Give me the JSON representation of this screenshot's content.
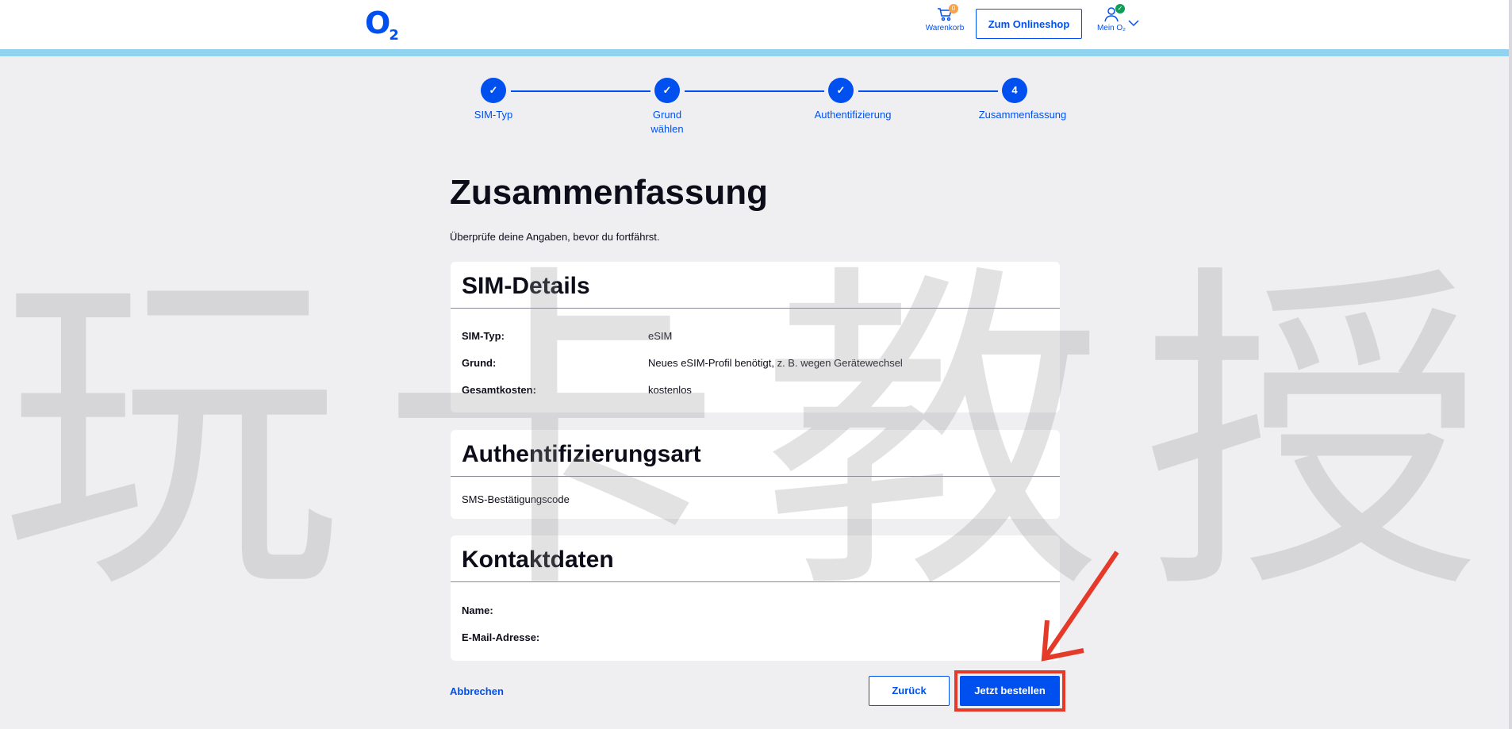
{
  "header": {
    "logo": "O",
    "logo_sub": "2",
    "cart_label": "Warenkorb",
    "cart_count": "0",
    "shop_button": "Zum Onlineshop",
    "account_label": "Mein O₂"
  },
  "stepper": {
    "steps": [
      {
        "label": "SIM-Typ",
        "state": "done"
      },
      {
        "label": "Grund wählen",
        "state": "done"
      },
      {
        "label": "Authentifizierung",
        "state": "done"
      },
      {
        "label": "Zusammenfassung",
        "number": "4",
        "state": "active"
      }
    ]
  },
  "main": {
    "title": "Zusammenfassung",
    "subtitle": "Überprüfe deine Angaben, bevor du fortfährst."
  },
  "sim_details": {
    "heading": "SIM-Details",
    "rows": [
      {
        "label": "SIM-Typ:",
        "value": "eSIM"
      },
      {
        "label": "Grund:",
        "value": "Neues eSIM-Profil benötigt, z. B. wegen Gerätewechsel"
      },
      {
        "label": "Gesamtkosten:",
        "value": "kostenlos"
      }
    ]
  },
  "auth": {
    "heading": "Authentifizierungsart",
    "value": "SMS-Bestätigungscode"
  },
  "contact": {
    "heading": "Kontaktdaten",
    "rows": [
      {
        "label": "Name:",
        "value": ""
      },
      {
        "label": "E-Mail-Adresse:",
        "value": ""
      }
    ]
  },
  "actions": {
    "cancel": "Abbrechen",
    "back": "Zurück",
    "order": "Jetzt bestellen"
  },
  "watermark": "玩卡教授",
  "colors": {
    "brand": "#0050f0",
    "background": "#efeff2",
    "highlight": "#e53a2a",
    "stripe": "#8fd3ee"
  }
}
